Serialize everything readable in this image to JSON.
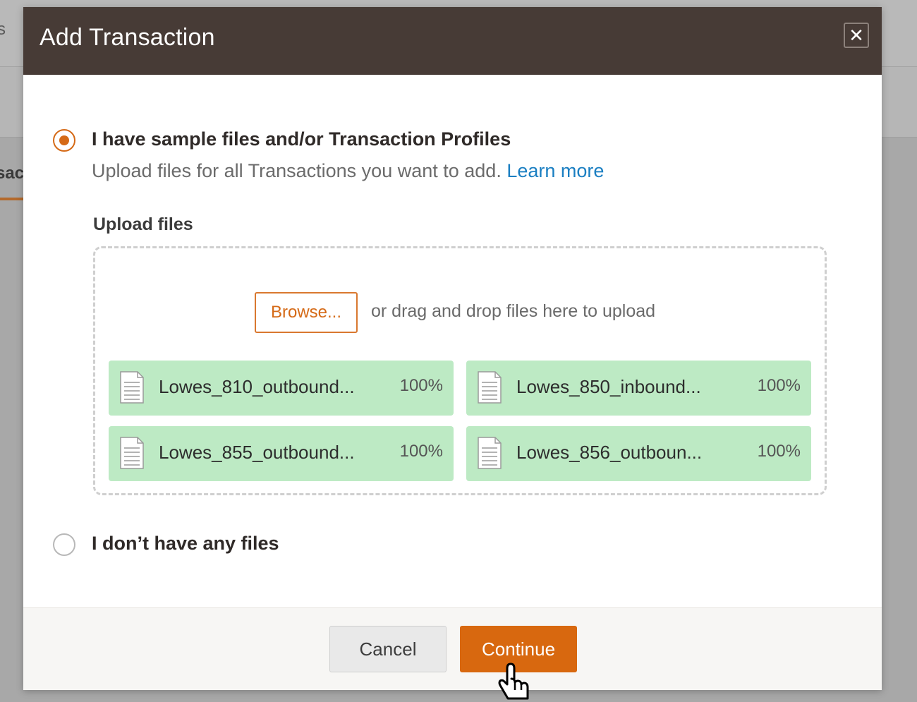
{
  "background": {
    "fragment_top": "s",
    "fragment_tab": "sac"
  },
  "dialog": {
    "title": "Add Transaction",
    "close_icon": "close-icon"
  },
  "option_files": {
    "label": "I have sample files and/or Transaction Profiles",
    "description": "Upload files for all Transactions you want to add.",
    "learn_more": "Learn more",
    "selected": true
  },
  "upload": {
    "label": "Upload files",
    "browse_label": "Browse...",
    "drop_hint": "or drag and drop files here to upload",
    "files": [
      {
        "name": "Lowes_810_outbound...",
        "progress": "100%"
      },
      {
        "name": "Lowes_850_inbound...",
        "progress": "100%"
      },
      {
        "name": "Lowes_855_outbound...",
        "progress": "100%"
      },
      {
        "name": "Lowes_856_outboun...",
        "progress": "100%"
      }
    ]
  },
  "option_no_files": {
    "label": "I don’t have any files",
    "selected": false
  },
  "footer": {
    "cancel_label": "Cancel",
    "continue_label": "Continue"
  },
  "colors": {
    "header_bg": "#473b36",
    "accent": "#d8680f",
    "file_success_bg": "#bdeac4",
    "link": "#1b7fc2"
  }
}
